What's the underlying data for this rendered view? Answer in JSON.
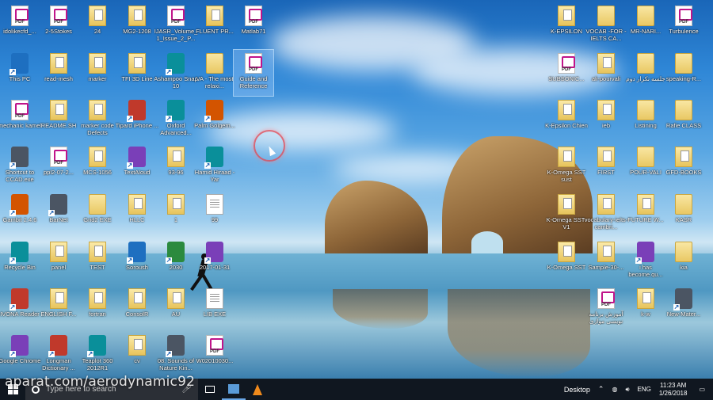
{
  "desktop": {
    "icons": [
      {
        "label": "idolikecfd_...",
        "type": "pdf"
      },
      {
        "label": "2-5Stokes",
        "type": "pdf"
      },
      {
        "label": "24",
        "type": "folderdoc"
      },
      {
        "label": "MG2-1208",
        "type": "folderdoc"
      },
      {
        "label": "IJASR_Volume_1_Issue_2_P...",
        "type": "pdf"
      },
      {
        "label": "FLUENT PR...",
        "type": "folderdoc"
      },
      {
        "label": "Matlab71",
        "type": "pdf"
      },
      {
        "label": "This PC",
        "type": "app"
      },
      {
        "label": "read-mesh",
        "type": "folderdoc"
      },
      {
        "label": "marker",
        "type": "folderdoc"
      },
      {
        "label": "TFI 3D Line",
        "type": "folderdoc"
      },
      {
        "label": "Ashampoo Snap 10",
        "type": "app"
      },
      {
        "label": "VA - The most relaxi...",
        "type": "folder"
      },
      {
        "label": "Guide and Reference",
        "type": "pdf"
      },
      {
        "label": "mechanic kamel",
        "type": "pdf"
      },
      {
        "label": "README.SH",
        "type": "folderdoc"
      },
      {
        "label": "marker code Defects",
        "type": "folderdoc"
      },
      {
        "label": "Tipard iPhone ...",
        "type": "app"
      },
      {
        "label": "Oxford Advanced...",
        "type": "app"
      },
      {
        "label": "Palm Golgem...",
        "type": "app"
      },
      {
        "label": "Shortcut to CCAD.exe",
        "type": "app"
      },
      {
        "label": "ppl2-07-2...",
        "type": "pdf"
      },
      {
        "label": "MCS-1056",
        "type": "folderdoc"
      },
      {
        "label": "TextAloud",
        "type": "app"
      },
      {
        "label": "93-96",
        "type": "folderdoc"
      },
      {
        "label": "Hamid Hiraad - Yar",
        "type": "app"
      },
      {
        "label": "Gambit 2.4.6",
        "type": "app"
      },
      {
        "label": "BarNet",
        "type": "app"
      },
      {
        "label": "Grid2 EXE",
        "type": "folder"
      },
      {
        "label": "HLLC",
        "type": "folderdoc"
      },
      {
        "label": "1",
        "type": "folderdoc"
      },
      {
        "label": "99",
        "type": "doc"
      },
      {
        "label": "Recycle Bin",
        "type": "app"
      },
      {
        "label": "panel",
        "type": "folderdoc"
      },
      {
        "label": "TEST",
        "type": "folderdoc"
      },
      {
        "label": "Soroush",
        "type": "app"
      },
      {
        "label": "2030",
        "type": "app"
      },
      {
        "label": "2017-01-31",
        "type": "app"
      },
      {
        "label": "IVONA Reader",
        "type": "app"
      },
      {
        "label": "ENGLISH F...",
        "type": "folderdoc"
      },
      {
        "label": "fortran",
        "type": "folderdoc"
      },
      {
        "label": "ConsolR",
        "type": "folderdoc"
      },
      {
        "label": "AU",
        "type": "folderdoc"
      },
      {
        "label": "LIB EXE",
        "type": "doc"
      },
      {
        "label": "Google Chrome",
        "type": "app"
      },
      {
        "label": "Longman Dictionary ...",
        "type": "app"
      },
      {
        "label": "Teaplot 360 2012R1",
        "type": "app"
      },
      {
        "label": "cv",
        "type": "folderdoc"
      },
      {
        "label": "08. Sounds of Nature Kin...",
        "type": "app"
      },
      {
        "label": "W02010030...",
        "type": "pdf"
      },
      {
        "label": "K-EPSILON",
        "type": "folderdoc"
      },
      {
        "label": "VOCAB -FOR -IELTS CA...",
        "type": "folder"
      },
      {
        "label": "MR-NARI...",
        "type": "folder"
      },
      {
        "label": "Turbulence",
        "type": "pdf"
      },
      {
        "label": "SUBSONIC...",
        "type": "pdf"
      },
      {
        "label": "ali-pourvali",
        "type": "folderdoc"
      },
      {
        "label": "جلسه تکرار دوم",
        "type": "folder"
      },
      {
        "label": "speaking-R...",
        "type": "folder"
      },
      {
        "label": "K-Epsilon Chien",
        "type": "folderdoc"
      },
      {
        "label": "ieb",
        "type": "folderdoc"
      },
      {
        "label": "Listining",
        "type": "folder"
      },
      {
        "label": "Rafie CLASS",
        "type": "folder"
      },
      {
        "label": "K-Omega SST sust",
        "type": "folderdoc"
      },
      {
        "label": "FIRST",
        "type": "folderdoc"
      },
      {
        "label": "POUR-VALI",
        "type": "folder"
      },
      {
        "label": "GFD-BOOKS",
        "type": "folderdoc"
      },
      {
        "label": "K-Omega SST-V1",
        "type": "folderdoc"
      },
      {
        "label": "vocabulary-ielts-cambri...",
        "type": "folderdoc"
      },
      {
        "label": "FUTURE W...",
        "type": "folderdoc"
      },
      {
        "label": "KASR",
        "type": "folder"
      },
      {
        "label": "K-Omega SST",
        "type": "folderdoc"
      },
      {
        "label": "Sample-30-...",
        "type": "folderdoc"
      },
      {
        "label": "i has become.qu...",
        "type": "app"
      },
      {
        "label": "kia",
        "type": "folder"
      },
      {
        "label": "آموزش برنامه نویسی موازی",
        "type": "pdf"
      },
      {
        "label": "k-w",
        "type": "folderdoc"
      },
      {
        "label": "New-Mater...",
        "type": "app"
      }
    ]
  },
  "taskbar": {
    "search_placeholder": "Type here to search",
    "desktop_label": "Desktop",
    "language": "ENG",
    "time": "11:23 AM",
    "date": "1/26/2018"
  },
  "watermark": "aparat.com/aerodynamic92",
  "colors": {
    "taskbar": "#101720",
    "accent": "#0078d7",
    "pdf": "#c0148a"
  }
}
